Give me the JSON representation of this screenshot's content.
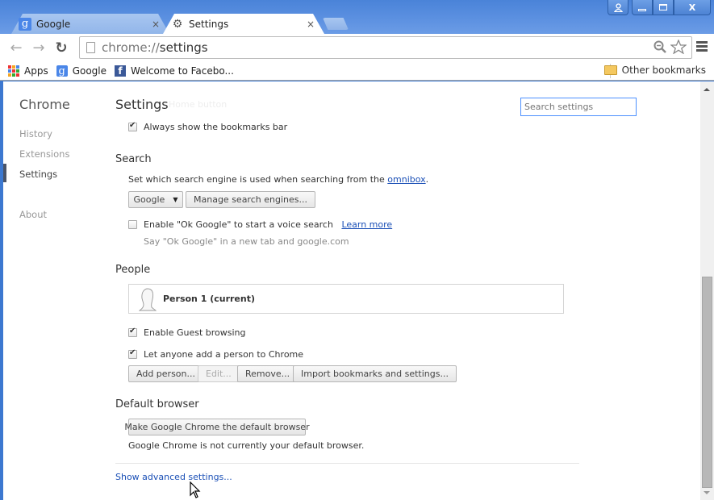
{
  "window": {
    "controls": {
      "user": "user-icon",
      "minimize": "minimize-icon",
      "maximize": "maximize-icon",
      "close": "X"
    }
  },
  "tabs": [
    {
      "title": "Google",
      "icon": "google-icon",
      "active": false
    },
    {
      "title": "Settings",
      "icon": "gear-icon",
      "active": true
    }
  ],
  "tab_close_glyph": "×",
  "toolbar": {
    "url_scheme": "chrome://",
    "url_path": "settings"
  },
  "bookmarks": {
    "items": [
      {
        "label": "Apps",
        "icon": "apps-grid-icon"
      },
      {
        "label": "Google",
        "icon": "google-icon"
      },
      {
        "label": "Welcome to Facebo...",
        "icon": "facebook-icon"
      }
    ],
    "other": "Other bookmarks"
  },
  "sidebar": {
    "title": "Chrome",
    "items": [
      {
        "label": "History",
        "selected": false
      },
      {
        "label": "Extensions",
        "selected": false
      },
      {
        "label": "Settings",
        "selected": true
      },
      {
        "label": "About",
        "selected": false
      }
    ]
  },
  "main": {
    "title": "Settings",
    "ghost_text": "Home button",
    "search_placeholder": "Search settings",
    "appearance": {
      "bookmarks_bar_label": "Always show the bookmarks bar",
      "bookmarks_bar_checked": true
    },
    "search": {
      "title": "Search",
      "description": "Set which search engine is used when searching from the",
      "omnibox_link": "omnibox",
      "description_end": ".",
      "engine_selected": "Google",
      "manage_button": "Manage search engines...",
      "ok_google_label": "Enable \"Ok Google\" to start a voice search",
      "ok_google_checked": false,
      "learn_more": "Learn more",
      "ok_google_hint": "Say \"Ok Google\" in a new tab and google.com"
    },
    "people": {
      "title": "People",
      "current_person": "Person 1 (current)",
      "guest_label": "Enable Guest browsing",
      "guest_checked": true,
      "add_person_label": "Let anyone add a person to Chrome",
      "add_person_checked": true,
      "buttons": {
        "add": "Add person...",
        "edit": "Edit...",
        "remove": "Remove...",
        "import": "Import bookmarks and settings..."
      }
    },
    "default_browser": {
      "title": "Default browser",
      "button": "Make Google Chrome the default browser",
      "status": "Google Chrome is not currently your default browser."
    },
    "advanced_link": "Show advanced settings..."
  },
  "scrollbar": {
    "position_fraction": 0.52,
    "visible_fraction": 0.52
  },
  "colors": {
    "frame": "#3c78d0",
    "link": "#1a4fb6",
    "search_focus": "#4d90fe",
    "nav_selected_bar": "#4a5468"
  }
}
